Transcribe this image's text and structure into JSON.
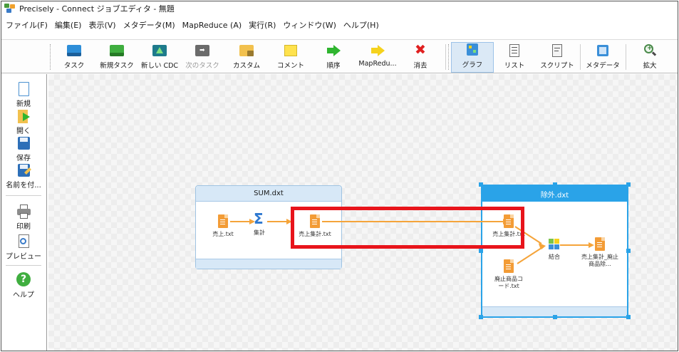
{
  "window": {
    "title": "Precisely - Connect ジョブエディタ - 無題"
  },
  "menu": [
    "ファイル(F)",
    "編集(E)",
    "表示(V)",
    "メタデータ(M)",
    "MapReduce (A)",
    "実行(R)",
    "ウィンドウ(W)",
    "ヘルプ(H)"
  ],
  "toolbar": {
    "task": "タスク",
    "new_task": "新規タスク",
    "new_cdc": "新しい CDC",
    "next_task": "次のタスク",
    "custom": "カスタム",
    "comment": "コメント",
    "sequence": "順序",
    "mapreduce": "MapRedu...",
    "delete": "消去",
    "graph": "グラフ",
    "list": "リスト",
    "script": "スクリプト",
    "metadata": "メタデータ",
    "zoom": "拡大"
  },
  "left_panel": {
    "new": "新規",
    "open": "開く",
    "save": "保存",
    "save_as": "名前を付...",
    "print": "印刷",
    "preview": "プレビュー",
    "help": "ヘルプ"
  },
  "jobs": {
    "sum": {
      "title": "SUM.dxt",
      "nodes": {
        "sales": "売上.txt",
        "aggregate": "集計",
        "sales_total": "売上集計.txt"
      }
    },
    "exclude": {
      "title": "除外.dxt",
      "nodes": {
        "sales_total": "売上集計.txt",
        "discontinued": "廃止商品コード.txt",
        "join": "結合",
        "result": "売上集計_廃止商品除..."
      }
    }
  },
  "colors": {
    "accent": "#2aa3e8",
    "highlight": "#e8141b",
    "file": "#f39c36",
    "arrow": "#f5a43a"
  }
}
